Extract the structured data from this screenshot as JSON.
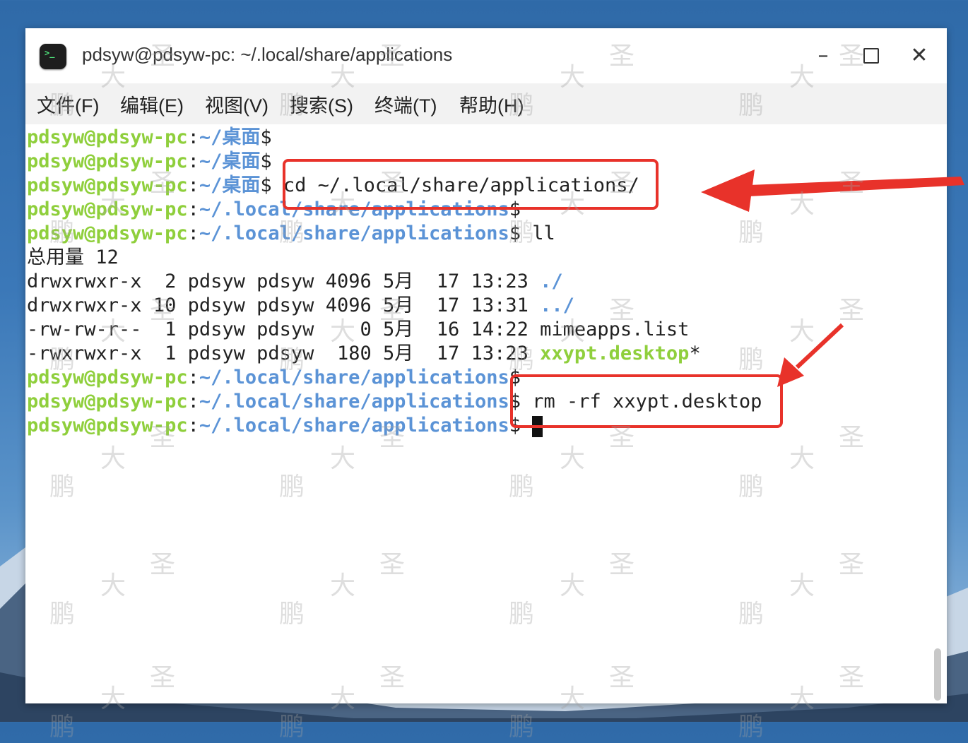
{
  "window": {
    "title": "pdsyw@pdsyw-pc: ~/.local/share/applications",
    "app_icon_glyph": ">_",
    "min_label": "–",
    "close_label": "✕"
  },
  "menubar": {
    "items": [
      "文件(F)",
      "编辑(E)",
      "视图(V)",
      "搜索(S)",
      "终端(T)",
      "帮助(H)"
    ]
  },
  "terminal": {
    "prompt_user": "pdsyw@pdsyw-pc",
    "desktop_path": "~/桌面",
    "apps_path": "~/.local/share/applications",
    "dollar": "$",
    "cmd_cd": " cd ~/.local/share/applications/",
    "cmd_ll": " ll",
    "total": "总用量 12",
    "listing": [
      {
        "perm": "drwxrwxr-x",
        "links": " 2",
        "user": "pdsyw",
        "group": "pdsyw",
        "size": "4096",
        "month": "5月",
        "day": "17",
        "time": "13:23",
        "name": "./"
      },
      {
        "perm": "drwxrwxr-x",
        "links": "10",
        "user": "pdsyw",
        "group": "pdsyw",
        "size": "4096",
        "month": "5月",
        "day": "17",
        "time": "13:31",
        "name": "../"
      },
      {
        "perm": "-rw-rw-r--",
        "links": " 1",
        "user": "pdsyw",
        "group": "pdsyw",
        "size": "   0",
        "month": "5月",
        "day": "16",
        "time": "14:22",
        "name": "mimeapps.list"
      },
      {
        "perm": "-rwxrwxr-x",
        "links": " 1",
        "user": "pdsyw",
        "group": "pdsyw",
        "size": " 180",
        "month": "5月",
        "day": "17",
        "time": "13:23",
        "name": "xxypt.desktop",
        "suffix": "*"
      }
    ],
    "cmd_rm": " rm -rf xxypt.desktop"
  },
  "annotations": {
    "accent_color": "#e8322a"
  },
  "watermark": {
    "chars": [
      "鹏",
      "大",
      "圣"
    ]
  }
}
